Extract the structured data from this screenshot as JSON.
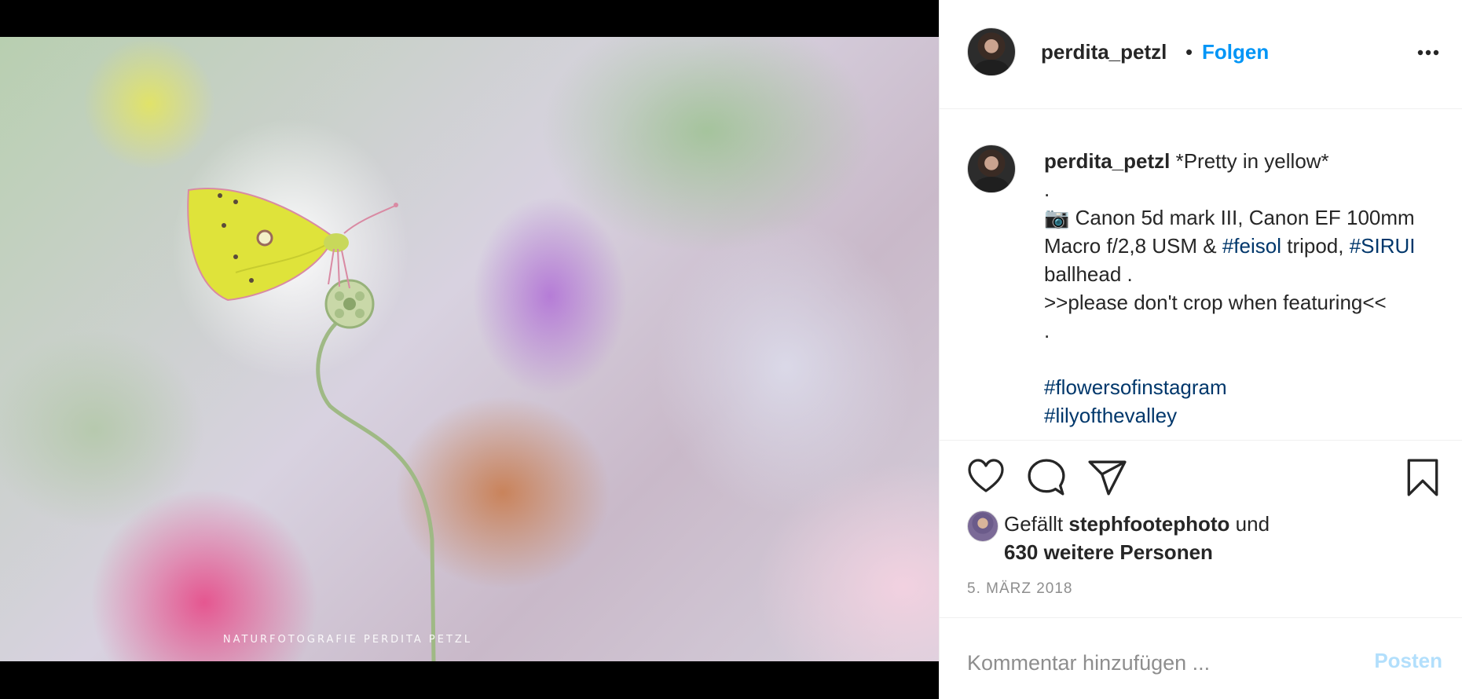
{
  "post": {
    "username": "perdita_petzl",
    "follow_label": "Folgen",
    "separator": "•",
    "watermark": "NATURFOTOGRAFIE PERDITA PETZL",
    "caption": {
      "username": "perdita_petzl",
      "title": " *Pretty in yellow*",
      "line_dot_1": ".",
      "camera_icon": "📷",
      "line_gear_a": " Canon 5d mark III, Canon EF 100mm Macro f/2,8 USM & ",
      "tag_feisol": "#feisol",
      "line_gear_b": " tripod, ",
      "tag_sirui": "#SIRUI",
      "line_gear_c": " ballhead .",
      "line_crop": ">>please don't crop when featuring<<",
      "line_dot_2": ".",
      "tag_flowers": "#flowersofinstagram",
      "tag_lily": "#lilyofthevalley"
    },
    "likes": {
      "prefix": "Gefällt ",
      "user": "stephfootephoto",
      "middle": " und",
      "count_text": "630 weitere Personen"
    },
    "date": "5. MÄRZ 2018",
    "comment": {
      "placeholder": "Kommentar hinzufügen ...",
      "post_label": "Posten"
    }
  },
  "icons": {
    "more": "more-icon",
    "like": "heart-icon",
    "comment": "comment-icon",
    "share": "share-icon",
    "save": "bookmark-icon"
  },
  "colors": {
    "accent": "#0095f6",
    "hashtag": "#00376b",
    "muted": "#8e8e8e",
    "post_disabled": "#b2dffc"
  }
}
